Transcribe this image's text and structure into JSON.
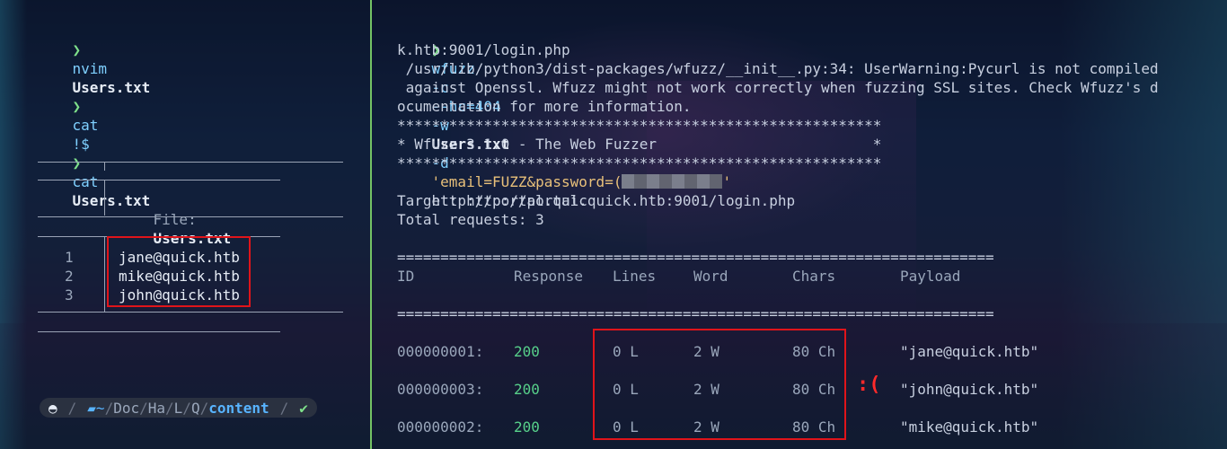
{
  "left": {
    "prompts": [
      {
        "cmd": "nvim",
        "arg": "Users.txt"
      },
      {
        "cmd": "cat",
        "arg": "!$"
      },
      {
        "cmd": "cat",
        "arg": "Users.txt"
      }
    ],
    "bat": {
      "file_label": "File:",
      "file_name": "Users.txt",
      "line_numbers": [
        "1",
        "2",
        "3"
      ],
      "lines": [
        "jane@quick.htb",
        "mike@quick.htb",
        "john@quick.htb"
      ]
    },
    "status_path": {
      "os_icon": "linux-penguin-icon",
      "tilde": "~",
      "parts": [
        "Doc",
        "Ha",
        "L",
        "Q"
      ],
      "current": "content",
      "status": "✔"
    }
  },
  "right": {
    "command": {
      "tool": "wfuzz",
      "flag1": "-c",
      "flag2": "--hc=404",
      "flag3": "-w",
      "wordlist": "Users.txt",
      "flag4": "-d",
      "data_prefix": "'email=FUZZ&password=(",
      "data_suffix": "'",
      "url_a": "http://portal.quic",
      "url_b": "k.htb:9001/login.php"
    },
    "warning": [
      " /usr/lib/python3/dist-packages/wfuzz/__init__.py:34: UserWarning:Pycurl is not compiled",
      " against Openssl. Wfuzz might not work correctly when fuzzing SSL sites. Check Wfuzz's d",
      "ocumentation for more information."
    ],
    "banner": [
      "********************************************************",
      "* Wfuzz 3.1.0 - The Web Fuzzer                         *",
      "********************************************************"
    ],
    "target": "Target: http://portal.quick.htb:9001/login.php",
    "total": "Total requests: 3",
    "rule": "=====================================================================",
    "headers": [
      "ID",
      "Response",
      "Lines",
      "Word",
      "Chars",
      "Payload"
    ],
    "rows": [
      {
        "id": "000000001:",
        "code": "200",
        "lines": "0 L",
        "words": "2 W",
        "chars": "80 Ch",
        "payload": "\"jane@quick.htb\""
      },
      {
        "id": "000000003:",
        "code": "200",
        "lines": "0 L",
        "words": "2 W",
        "chars": "80 Ch",
        "payload": "\"john@quick.htb\""
      },
      {
        "id": "000000002:",
        "code": "200",
        "lines": "0 L",
        "words": "2 W",
        "chars": "80 Ch",
        "payload": "\"mike@quick.htb\""
      }
    ],
    "annotation": ":("
  },
  "colors": {
    "highlight_box": "#e0141a",
    "prompt_arrow": "#7ee08a",
    "divider": "#74c365",
    "status_code": "#57d08a"
  }
}
